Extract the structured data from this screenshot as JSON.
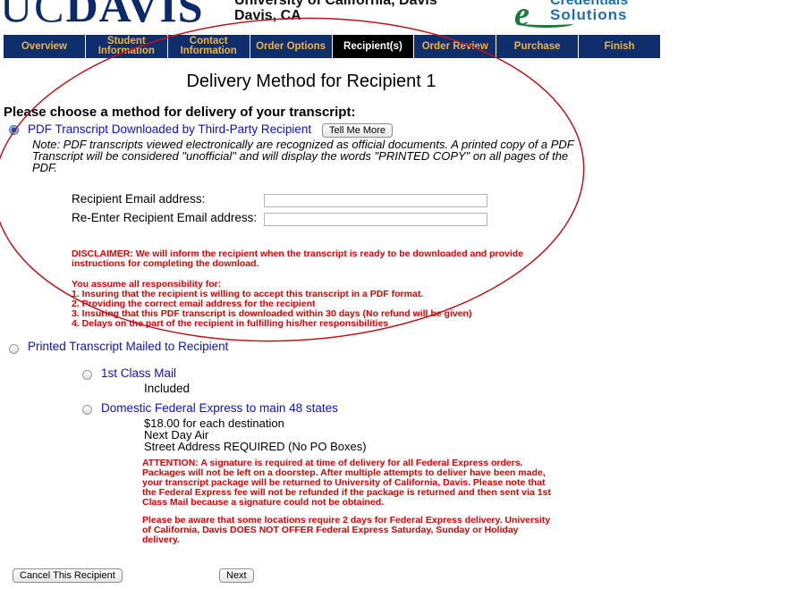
{
  "header": {
    "logo_uc": "UC",
    "logo_davis": "DAVIS",
    "university_line1": "University of California, Davis",
    "university_line2": "Davis, CA",
    "brand_e": "e",
    "brand_line1": "Credentials",
    "brand_line2": "Solutions"
  },
  "nav": {
    "tabs": [
      {
        "label": "Overview"
      },
      {
        "label": "Student Information"
      },
      {
        "label": "Contact Information"
      },
      {
        "label": "Order Options"
      },
      {
        "label": "Recipient(s)"
      },
      {
        "label": "Order Review"
      },
      {
        "label": "Purchase"
      },
      {
        "label": "Finish"
      }
    ],
    "active": "Recipient(s)"
  },
  "page": {
    "title": "Delivery Method for Recipient 1",
    "prompt": "Please choose a method for delivery of your transcript:"
  },
  "pdf_option": {
    "label": "PDF Transcript Downloaded by Third-Party Recipient",
    "selected": true,
    "tell_me_more": "Tell Me More",
    "note": "Note: PDF transcripts viewed electronically are recognized as official documents. A printed copy of a PDF Transcript will be considered \"unofficial\" and will display the words \"PRINTED COPY\" on all pages of the PDF.",
    "email_label": "Recipient Email address:",
    "email_value": "",
    "reenter_label": "Re-Enter Recipient Email address:",
    "reenter_value": "",
    "disclaimer": "DISCLAIMER: We will inform the recipient when the transcript is ready to be downloaded and provide instructions for completing the download.",
    "responsibility_heading": "You assume all responsibility for:",
    "responsibilities": [
      "1. Insuring that the recipient is willing to accept this transcript in a PDF format.",
      "2. Providing the correct email address for the recipient",
      "3. Insuring that this PDF transcript is downloaded within 30 days (No refund will be given)",
      "4. Delays on the part of the recipient in fulfilling his/her responsibilities"
    ]
  },
  "mail_option": {
    "label": "Printed Transcript Mailed to Recipient",
    "selected": false,
    "first_class": {
      "label": "1st Class Mail",
      "detail": "Included"
    },
    "fedex": {
      "label": "Domestic Federal Express to main 48 states",
      "price": "$18.00 for each destination",
      "speed": "Next Day Air",
      "address": "Street Address REQUIRED (No PO Boxes)",
      "attention": "ATTENTION: A signature is required at time of delivery for all Federal Express orders. Packages will not be left on a doorstep. After multiple attempts to deliver have been made, your transcript package will be returned to University of California, Davis. Please note that the Federal Express fee will not be refunded if the package is returned and then sent via 1st Class Mail because a signature could not be obtained.",
      "aware": "Please be aware that some locations require 2 days for Federal Express delivery. University of California, Davis DOES NOT OFFER Federal Express Saturday, Sunday or Holiday delivery."
    }
  },
  "buttons": {
    "cancel": "Cancel This Recipient",
    "next": "Next"
  },
  "colors": {
    "nav_bg": "#0e2e6e",
    "nav_text": "#f2b233",
    "link_blue": "#1010c8",
    "warning_red": "#e00000",
    "annotation_red": "#c0141c"
  }
}
